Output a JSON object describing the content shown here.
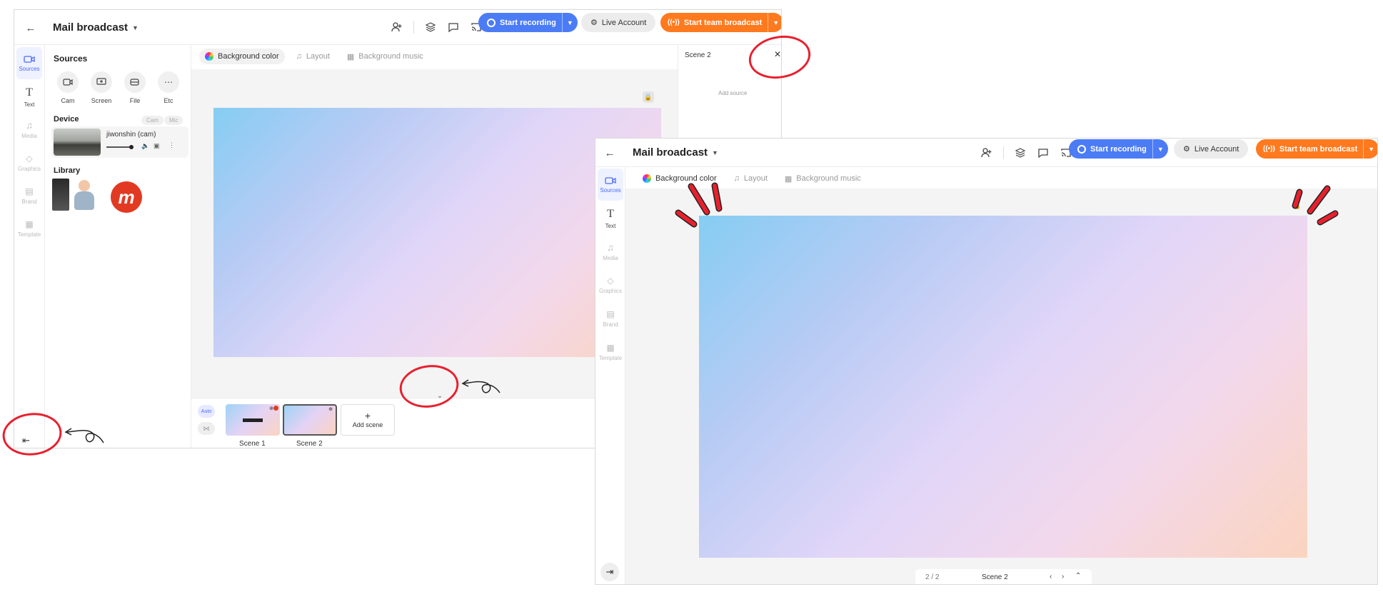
{
  "header": {
    "title": "Mail broadcast",
    "start_recording": "Start recording",
    "live_account": "Live Account",
    "team_broadcast": "Start team broadcast"
  },
  "rail": {
    "items": [
      {
        "label": "Sources"
      },
      {
        "label": "Text"
      },
      {
        "label": "Media"
      },
      {
        "label": "Graphics"
      },
      {
        "label": "Brand"
      },
      {
        "label": "Template"
      }
    ]
  },
  "toolbar": {
    "background_color": "Background color",
    "layout": "Layout",
    "background_music": "Background music"
  },
  "sources": {
    "title": "Sources",
    "buttons": [
      {
        "label": "Cam"
      },
      {
        "label": "Screen"
      },
      {
        "label": "File"
      },
      {
        "label": "Etc"
      }
    ],
    "device_title": "Device",
    "device_tabs": [
      "Cam",
      "Mic"
    ],
    "device_name": "jiwonshin (cam)",
    "library_title": "Library"
  },
  "scene_panel": {
    "title": "Scene 2",
    "add_source": "Add source"
  },
  "scenes": {
    "auto": "Auto",
    "items": [
      {
        "label": "Scene 1"
      },
      {
        "label": "Scene 2"
      }
    ],
    "add_scene": "Add scene"
  },
  "footer": {
    "page": "2 / 2",
    "scene_name": "Scene 2"
  },
  "colors": {
    "accent_blue": "#4b7cf6",
    "accent_orange": "#ff7a1f",
    "annotation_red": "#e8202e"
  }
}
